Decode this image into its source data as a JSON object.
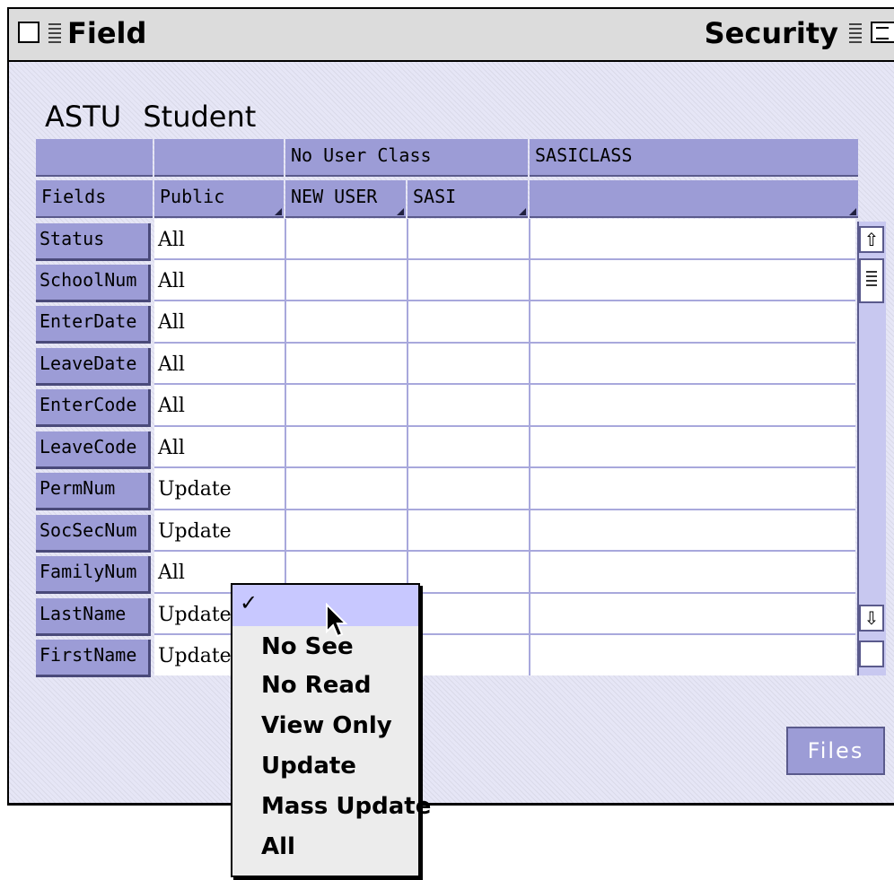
{
  "window": {
    "title_left": "Field",
    "title_right": "Security"
  },
  "file": {
    "code": "ASTU",
    "name": "Student"
  },
  "table": {
    "group_headers": [
      "",
      "",
      "No User Class",
      "SASICLASS"
    ],
    "column_headers": [
      "Fields",
      "Public",
      "NEW USER",
      "SASI",
      ""
    ],
    "rows": [
      {
        "field": "Status",
        "public": "All"
      },
      {
        "field": "SchoolNum",
        "public": "All"
      },
      {
        "field": "EnterDate",
        "public": "All"
      },
      {
        "field": "LeaveDate",
        "public": "All"
      },
      {
        "field": "EnterCode",
        "public": "All"
      },
      {
        "field": "LeaveCode",
        "public": "All"
      },
      {
        "field": "PermNum",
        "public": "Update"
      },
      {
        "field": "SocSecNum",
        "public": "Update"
      },
      {
        "field": "FamilyNum",
        "public": "All"
      },
      {
        "field": "LastName",
        "public": "Update"
      },
      {
        "field": "FirstName",
        "public": "Update"
      }
    ]
  },
  "popup_menu": {
    "check_glyph": "✓",
    "items": [
      "No See",
      "No Read",
      "View Only",
      "Update",
      "Mass Update",
      "All"
    ]
  },
  "buttons": {
    "files": "Files"
  },
  "icons": {
    "scroll_up": "⇧",
    "scroll_down": "⇩"
  },
  "colors": {
    "header": "#9c9cd6",
    "background": "#e6e6f6",
    "selection": "#c8c8ff"
  }
}
